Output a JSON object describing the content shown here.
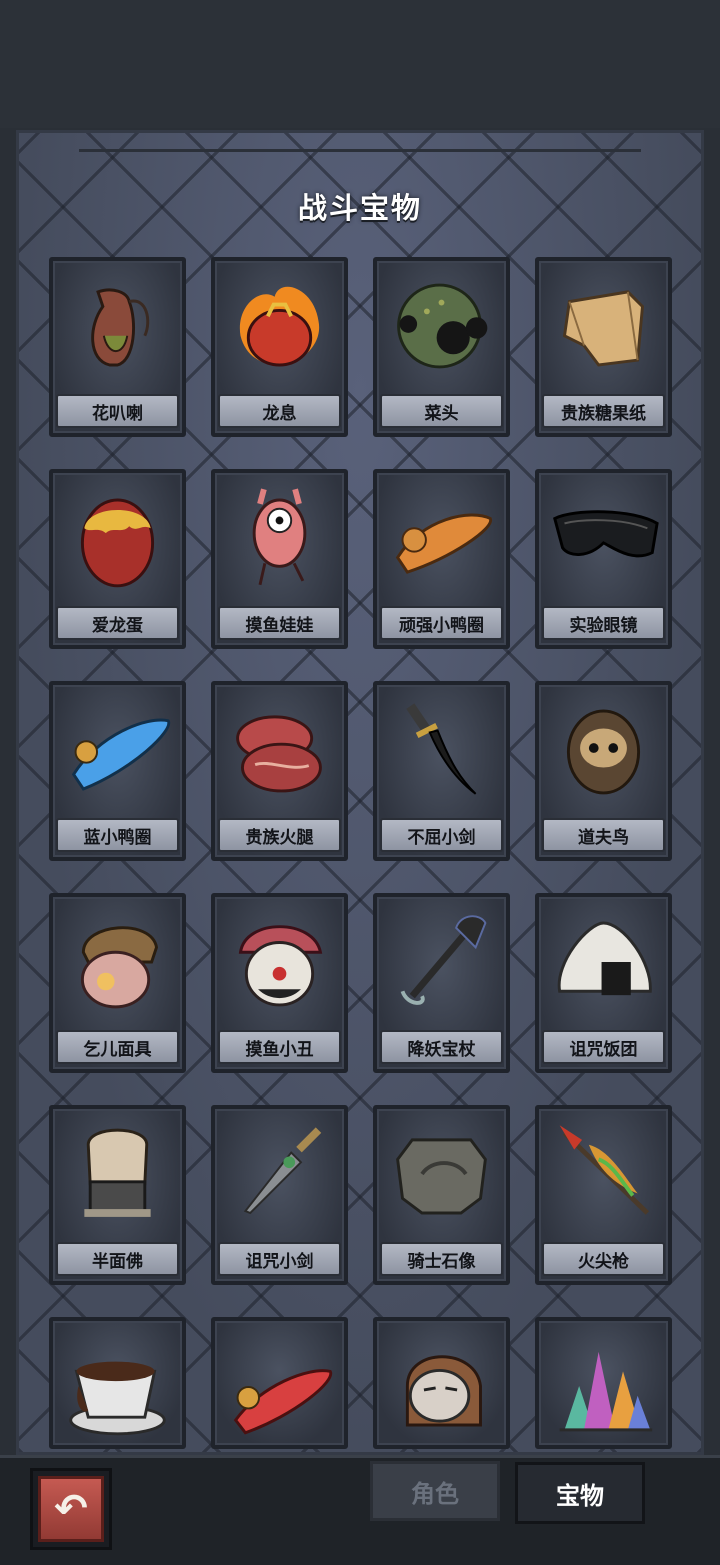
{
  "panel": {
    "title": "战斗宝物"
  },
  "items": [
    {
      "name": "花叭喇",
      "icon": "pitcher-plant-icon"
    },
    {
      "name": "龙息",
      "icon": "flaming-heart-icon"
    },
    {
      "name": "菜头",
      "icon": "green-orb-icon"
    },
    {
      "name": "贵族糖果纸",
      "icon": "candy-wrapper-icon"
    },
    {
      "name": "爱龙蛋",
      "icon": "dragon-egg-icon"
    },
    {
      "name": "摸鱼娃娃",
      "icon": "pink-doll-icon"
    },
    {
      "name": "顽强小鸭圈",
      "icon": "orange-duck-ring-icon"
    },
    {
      "name": "实验眼镜",
      "icon": "black-goggles-icon"
    },
    {
      "name": "蓝小鸭圈",
      "icon": "blue-duck-ring-icon"
    },
    {
      "name": "贵族火腿",
      "icon": "ham-steak-icon"
    },
    {
      "name": "不屈小剑",
      "icon": "short-sword-icon"
    },
    {
      "name": "道夫鸟",
      "icon": "owl-icon"
    },
    {
      "name": "乞儿面具",
      "icon": "beggar-mask-icon"
    },
    {
      "name": "摸鱼小丑",
      "icon": "clown-mask-icon"
    },
    {
      "name": "降妖宝杖",
      "icon": "demon-staff-icon"
    },
    {
      "name": "诅咒饭团",
      "icon": "rice-ball-icon"
    },
    {
      "name": "半面佛",
      "icon": "half-buddha-icon"
    },
    {
      "name": "诅咒小剑",
      "icon": "cursed-dagger-icon"
    },
    {
      "name": "骑士石像",
      "icon": "stone-tablet-icon"
    },
    {
      "name": "火尖枪",
      "icon": "fire-spear-icon"
    }
  ],
  "partial_items": [
    {
      "icon": "coffee-cup-icon"
    },
    {
      "icon": "red-duck-ring-icon"
    },
    {
      "icon": "helmet-face-icon"
    },
    {
      "icon": "crystal-cluster-icon"
    }
  ],
  "nav": {
    "back_icon": "back-arrow-icon",
    "back_glyph": "↶",
    "tabs": [
      {
        "label": "角色",
        "active": false
      },
      {
        "label": "宝物",
        "active": true
      }
    ]
  }
}
